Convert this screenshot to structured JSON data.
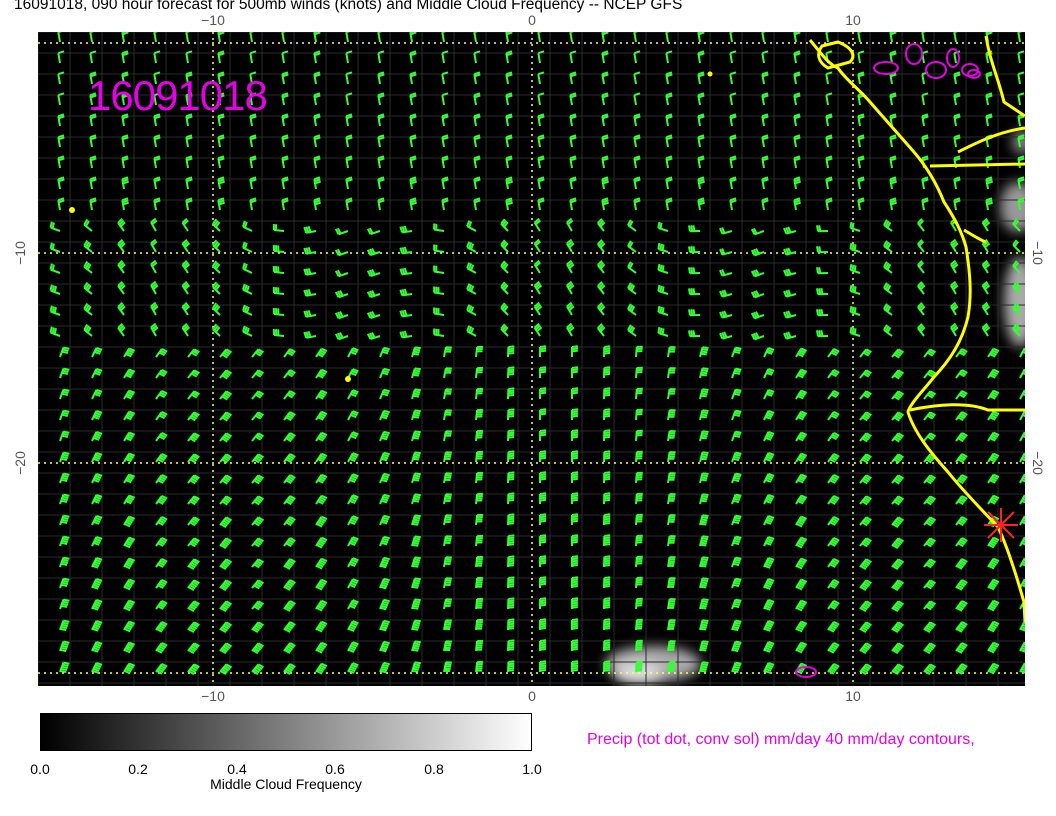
{
  "title": "16091018, 090 hour forecast for 500mb winds (knots) and Middle Cloud Frequency -- NCEP GFS",
  "stamp": "16091018",
  "axes": {
    "top": [
      "−10",
      "0",
      "10"
    ],
    "bottom": [
      "−10",
      "0",
      "10"
    ],
    "left": [
      "−10",
      "−20"
    ],
    "right": [
      "−10",
      "−20"
    ]
  },
  "colorbar": {
    "label": "Middle Cloud Frequency",
    "ticks": [
      "0.0",
      "0.2",
      "0.4",
      "0.6",
      "0.8",
      "1.0"
    ],
    "colors": [
      "#000000",
      "#ffffff"
    ]
  },
  "precip_note": "Precip (tot dot, conv sol) mm/day 40 mm/day contours,",
  "colors": {
    "wind_barbs": "#33ff33",
    "coastline": "#ffff00",
    "precip": "#e600e6",
    "gridlines": "#ffff66",
    "marker": "#ff2222"
  },
  "map_layers": [
    "wind-barbs",
    "coastline",
    "lat-lon-grid",
    "cloud-shading",
    "precip-contours",
    "location-marker"
  ]
}
